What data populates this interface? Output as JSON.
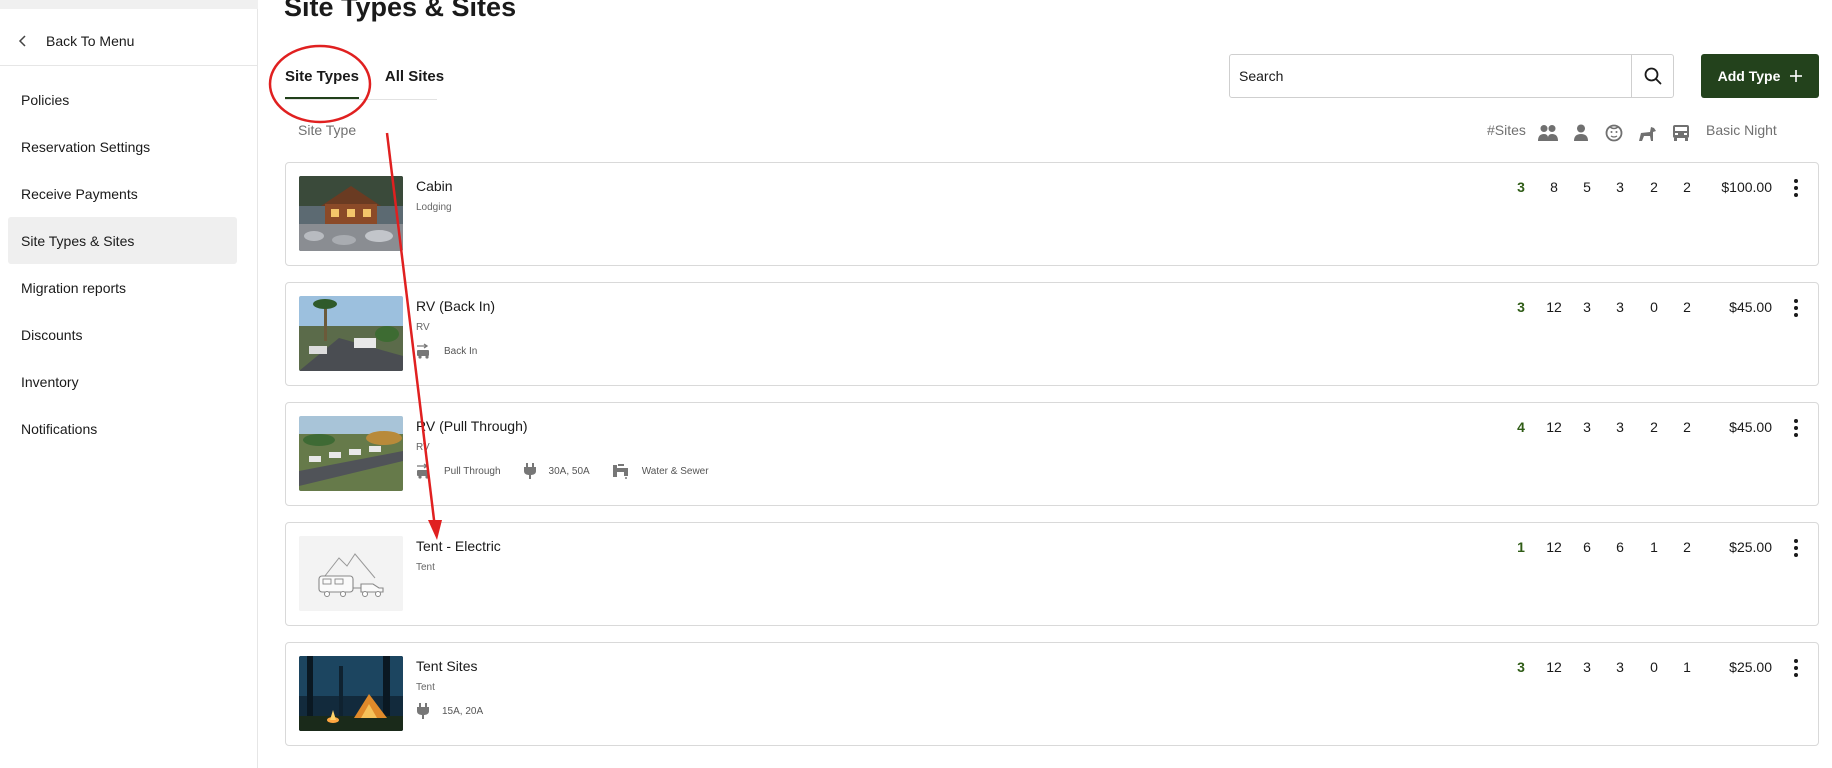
{
  "sidebar": {
    "back_label": "Back To Menu",
    "items": [
      {
        "label": "Policies",
        "active": false
      },
      {
        "label": "Reservation Settings",
        "active": false
      },
      {
        "label": "Receive Payments",
        "active": false
      },
      {
        "label": "Site Types & Sites",
        "active": true
      },
      {
        "label": "Migration reports",
        "active": false
      },
      {
        "label": "Discounts",
        "active": false
      },
      {
        "label": "Inventory",
        "active": false
      },
      {
        "label": "Notifications",
        "active": false
      }
    ]
  },
  "header": {
    "title": "Site Types & Sites",
    "tabs": [
      {
        "label": "Site Types",
        "active": true
      },
      {
        "label": "All Sites",
        "active": false
      }
    ],
    "search_placeholder": "Search",
    "add_button_label": "Add Type"
  },
  "columns": {
    "site_type": "Site Type",
    "sites": "#Sites",
    "icons": [
      "group-icon",
      "person-icon",
      "child-icon",
      "pet-icon",
      "vehicle-icon"
    ],
    "price": "Basic Night"
  },
  "rows": [
    {
      "name": "Cabin",
      "category": "Lodging",
      "amenities": [],
      "sites": "3",
      "values": [
        "8",
        "5",
        "3",
        "2",
        "2"
      ],
      "price": "$100.00"
    },
    {
      "name": "RV (Back In)",
      "category": "RV",
      "amenities": [
        {
          "icon": "rv-hookup-icon",
          "label": "Back In"
        }
      ],
      "sites": "3",
      "values": [
        "12",
        "3",
        "3",
        "0",
        "2"
      ],
      "price": "$45.00"
    },
    {
      "name": "RV (Pull Through)",
      "category": "RV",
      "amenities": [
        {
          "icon": "rv-hookup-icon",
          "label": "Pull Through"
        },
        {
          "icon": "power-plug-icon",
          "label": "30A, 50A"
        },
        {
          "icon": "water-faucet-icon",
          "label": "Water & Sewer"
        }
      ],
      "sites": "4",
      "values": [
        "12",
        "3",
        "3",
        "2",
        "2"
      ],
      "price": "$45.00"
    },
    {
      "name": "Tent - Electric",
      "category": "Tent",
      "amenities": [],
      "sites": "1",
      "values": [
        "12",
        "6",
        "6",
        "1",
        "2"
      ],
      "price": "$25.00"
    },
    {
      "name": "Tent Sites",
      "category": "Tent",
      "amenities": [
        {
          "icon": "power-plug-icon",
          "label": "15A, 20A"
        }
      ],
      "sites": "3",
      "values": [
        "12",
        "3",
        "3",
        "0",
        "1"
      ],
      "price": "$25.00"
    }
  ],
  "colors": {
    "accent": "#23421c",
    "sites_count": "#2f5c16",
    "annotation": "#e02020"
  }
}
